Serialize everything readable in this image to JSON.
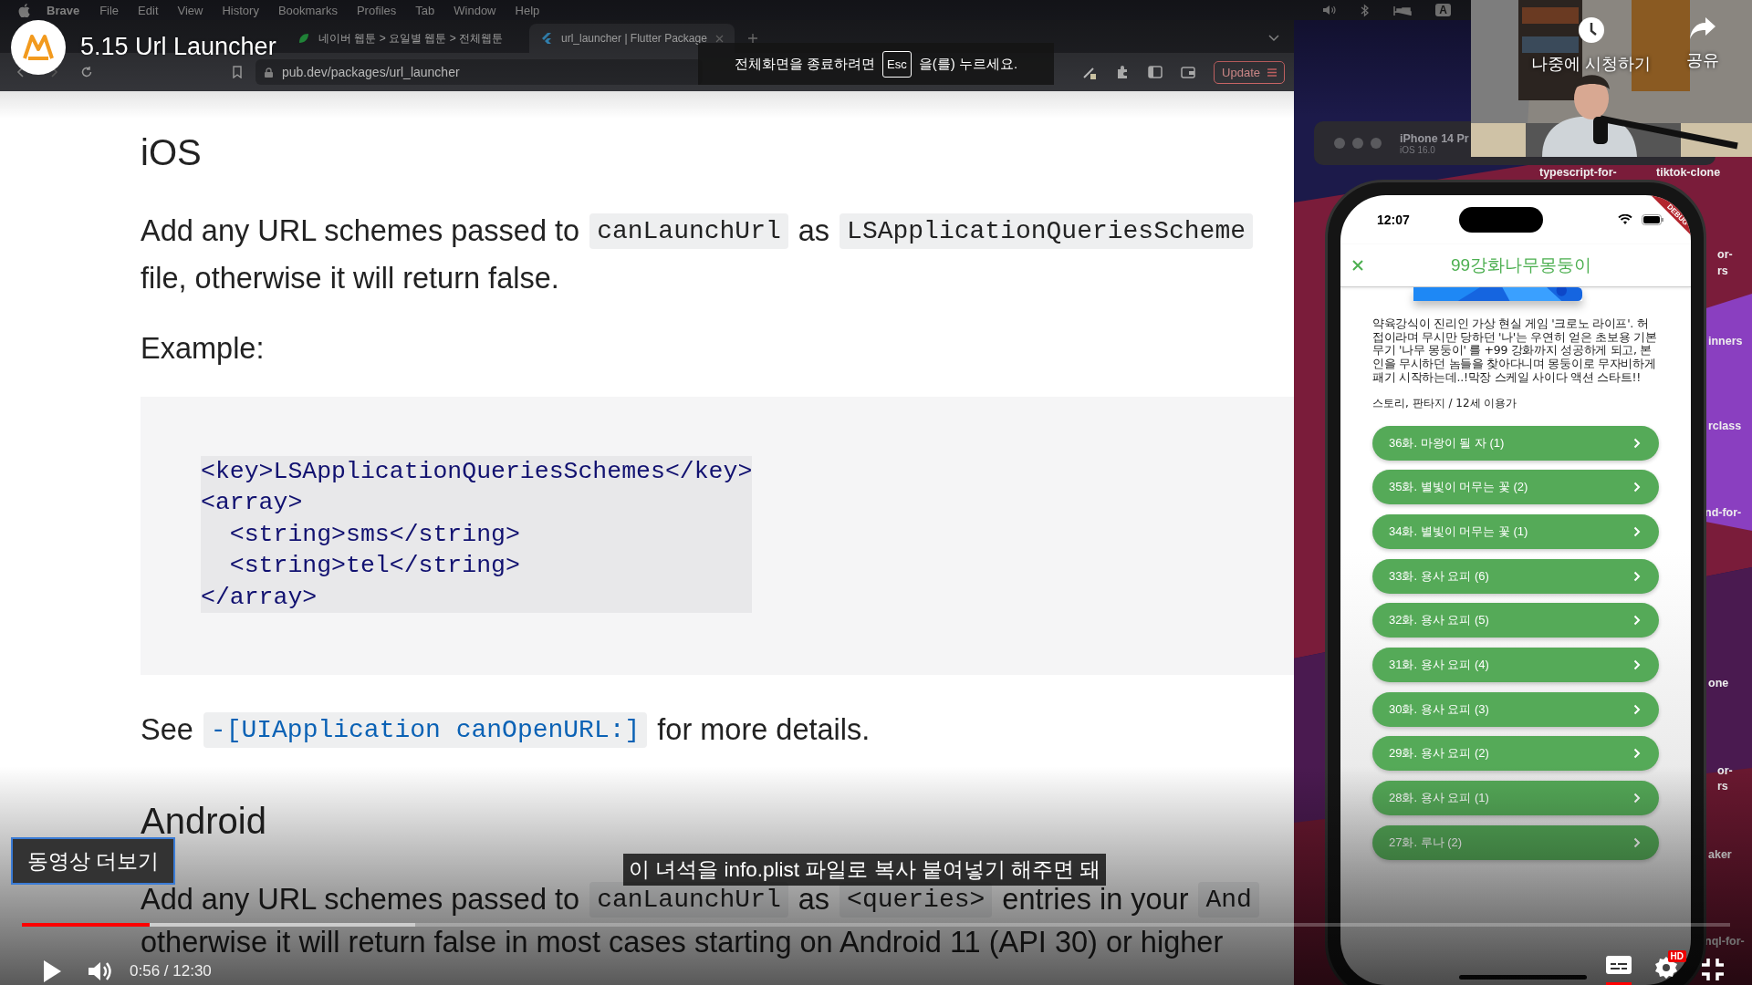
{
  "player": {
    "title": "5.15 Url Launcher",
    "fullscreen_hint": {
      "before": "전체화면을 종료하려면",
      "key": "Esc",
      "after": "을(를) 누르세요."
    },
    "watch_later": "나중에 시청하기",
    "share": "공유",
    "more_videos": "동영상 더보기",
    "subtitle": "이 녀석을 info.plist 파일로 복사 붙여넣기 해주면 돼",
    "time": "0:56 / 12:30",
    "progress": {
      "level": 0.075
    },
    "buffered": {
      "level": 0.23
    },
    "captions": {
      "on": true
    },
    "quality_badge": "HD"
  },
  "menu_bar": {
    "app": "Brave",
    "items": [
      "File",
      "Edit",
      "View",
      "History",
      "Bookmarks",
      "Profiles",
      "Tab",
      "Window",
      "Help"
    ],
    "input_source": "A"
  },
  "tabs": [
    {
      "label": "네이버 웹툰 > 요일별 웹툰 > 전체웹툰",
      "selected": false
    },
    {
      "label": "url_launcher | Flutter Package",
      "selected": true
    }
  ],
  "address": "pub.dev/packages/url_launcher",
  "update_button": "Update",
  "doc": [
    {
      "kind": "heading",
      "text": "iOS"
    },
    {
      "kind": "paragraph",
      "lines": [
        [
          {
            "kind": "text",
            "text": "Add any URL schemes passed to"
          },
          {
            "kind": "code",
            "text": "canLaunchUrl"
          },
          {
            "kind": "text",
            "text": "as"
          },
          {
            "kind": "code",
            "text": "LSApplicationQueriesScheme"
          }
        ],
        [
          {
            "kind": "text",
            "text": "file, otherwise it will return false."
          }
        ]
      ]
    },
    {
      "kind": "paragraph",
      "lines": [
        [
          {
            "kind": "text",
            "text": "Example:"
          }
        ]
      ]
    },
    {
      "kind": "code_block",
      "lines": [
        "<key>LSApplicationQueriesSchemes</key>",
        "<array>",
        "  <string>sms</string>",
        "  <string>tel</string>",
        "</array>"
      ]
    },
    {
      "kind": "paragraph",
      "lines": [
        [
          {
            "kind": "text",
            "text": "See"
          },
          {
            "kind": "link",
            "text": "-[UIApplication canOpenURL:]"
          },
          {
            "kind": "text",
            "text": "for more details."
          }
        ]
      ]
    },
    {
      "kind": "heading",
      "text": "Android"
    },
    {
      "kind": "paragraph",
      "lines": [
        [
          {
            "kind": "text",
            "text": "Add any URL schemes passed to"
          },
          {
            "kind": "code",
            "text": "canLaunchUrl"
          },
          {
            "kind": "text",
            "text": "as"
          },
          {
            "kind": "code",
            "text": "<queries>"
          },
          {
            "kind": "text",
            "text": "entries in your"
          },
          {
            "kind": "code",
            "text": "And"
          }
        ],
        [
          {
            "kind": "text",
            "text": "otherwise it will return false in most cases starting on Android 11 (API 30) or higher"
          }
        ]
      ]
    }
  ],
  "simulator": {
    "device": "iPhone 14 Pr",
    "os": "iOS 16.0"
  },
  "desktop_labels": [
    "typescript-for-",
    "tiktok-clone",
    "or-",
    "rs",
    "inners",
    "rclass",
    "nd-for-",
    "one",
    "or-",
    "rs",
    "aker",
    "nql-for-"
  ],
  "phone": {
    "time": "12:07",
    "debug_banner": "DEBUG",
    "title": "99강화나무몽둥이",
    "description": "약육강식이 진리인 가상 현실 게임 '크로노 라이프'. 허접이라며 무시만 당하던 '나'는 우연히 얻은 초보용 기본 무기 '나무 몽둥이' 를 +99 강화까지 성공하게 되고, 본인을 무시하던 놈들을 찾아다니며 몽둥이로 무자비하게 패기 시작하는데..!막장 스케일 사이다 액션 스타트!!",
    "genre": "스토리, 판타지 / 12세 이용가",
    "episodes": [
      "36화. 마왕이 될 자 (1)",
      "35화. 별빛이 머무는 꽃 (2)",
      "34화. 별빛이 머무는 꽃 (1)",
      "33화. 용사 요피 (6)",
      "32화. 용사 요피 (5)",
      "31화. 용사 요피 (4)",
      "30화. 용사 요피 (3)",
      "29화. 용사 요피 (2)",
      "28화. 용사 요피 (1)",
      "27화. 루나 (2)"
    ]
  }
}
